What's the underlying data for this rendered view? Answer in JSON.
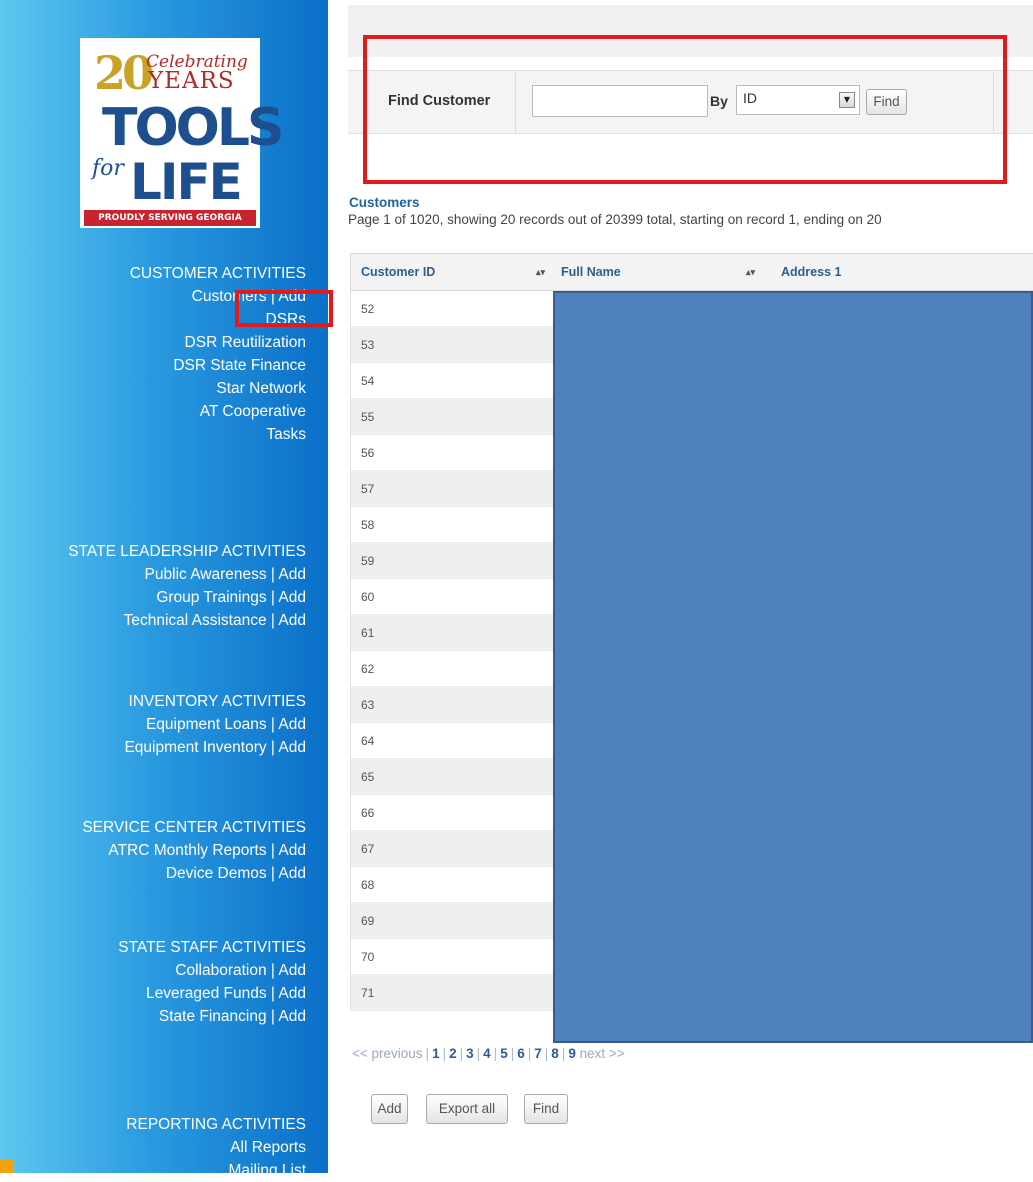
{
  "logo": {
    "twenty": "20",
    "celebrating": "Celebrating",
    "years": "YEARS",
    "tools": "TOOLS",
    "for": "for",
    "life": "LIFE",
    "banner": "PROUDLY SERVING GEORGIA"
  },
  "sidebar": {
    "customer_activities": "CUSTOMER ACTIVITIES",
    "customers": "Customers",
    "add": "Add",
    "sep": " | ",
    "dsrs": "DSRs",
    "dsr_reutilization": "DSR Reutilization",
    "dsr_state_finance": "DSR State Finance",
    "star_network": "Star Network",
    "at_cooperative": "AT Cooperative",
    "tasks": "Tasks",
    "state_leadership": "STATE LEADERSHIP ACTIVITIES",
    "public_awareness": "Public Awareness",
    "group_trainings": "Group Trainings",
    "technical_assistance": "Technical Assistance",
    "inventory": "INVENTORY ACTIVITIES",
    "equipment_loans": "Equipment Loans",
    "equipment_inventory": "Equipment Inventory",
    "service_center": "SERVICE CENTER ACTIVITIES",
    "atrc_monthly": "ATRC Monthly Reports",
    "device_demos": "Device Demos",
    "state_staff": "STATE STAFF ACTIVITIES",
    "collaboration": "Collaboration",
    "leveraged_funds": "Leveraged Funds",
    "state_financing": "State Financing",
    "reporting": "REPORTING ACTIVITIES",
    "all_reports": "All Reports",
    "mailing_list": "Mailing List"
  },
  "find": {
    "label": "Find Customer",
    "value": "",
    "by_label": "By",
    "by_value": "ID",
    "button": "Find"
  },
  "main": {
    "section_title": "Customers",
    "page_info": "Page 1 of 1020, showing 20 records out of 20399 total, starting on record 1, ending on 20"
  },
  "table": {
    "headers": [
      "Customer ID",
      "Full Name",
      "Address 1"
    ],
    "sort_glyph": "▴▾",
    "ids": [
      "52",
      "53",
      "54",
      "55",
      "56",
      "57",
      "58",
      "59",
      "60",
      "61",
      "62",
      "63",
      "64",
      "65",
      "66",
      "67",
      "68",
      "69",
      "70",
      "71"
    ]
  },
  "pager": {
    "previous": "<< previous",
    "pages": [
      "1",
      "2",
      "3",
      "4",
      "5",
      "6",
      "7",
      "8",
      "9"
    ],
    "next": "next >>"
  },
  "buttons": {
    "add": "Add",
    "export_all": "Export all",
    "find": "Find"
  },
  "colors": {
    "sidebar_start": "#5ec8f0",
    "sidebar_end": "#0a6fc8",
    "annotation_red": "#e31a1c",
    "mask_blue": "#4f81bd",
    "link_blue": "#23639b"
  }
}
